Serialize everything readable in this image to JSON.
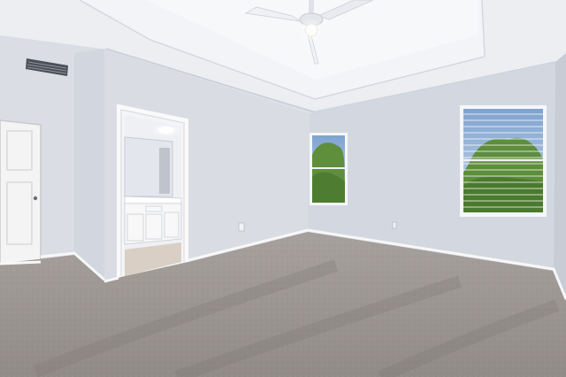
{
  "scene": {
    "kind": "empty-bedroom-interior",
    "elements": [
      "tray-ceiling",
      "ceiling-fan",
      "air-vent",
      "closet-door",
      "bathroom-doorway",
      "bathroom-vanity",
      "mirror",
      "window-left",
      "window-right",
      "wall-outlet",
      "carpet-floor",
      "baseboard"
    ]
  },
  "colors": {
    "ceiling": "#eef0f4",
    "wall_back": "#d7dbe3",
    "wall_left": "#dcdfe6",
    "wall_side": "#cfd3db",
    "carpet": "#9d9794",
    "carpet_dark": "#8b8582",
    "trim": "#f7f7f7",
    "window_sky": "#8fb0d8",
    "foliage": "#5c8f3c"
  }
}
